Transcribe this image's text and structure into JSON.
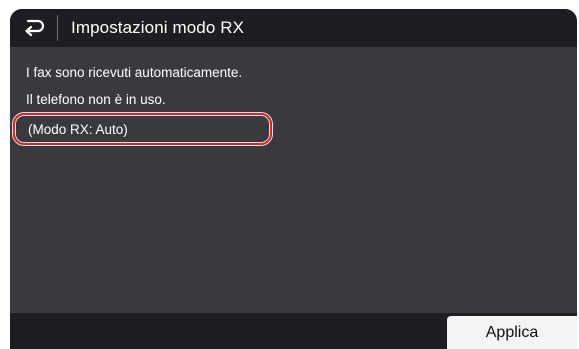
{
  "header": {
    "title": "Impostazioni modo RX",
    "back_icon": "back-arrow-icon"
  },
  "content": {
    "lines": [
      "I fax sono ricevuti automaticamente.",
      "Il telefono non è in uso.",
      "(Modo RX: Auto)"
    ],
    "highlight_color": "#d9262c"
  },
  "footer": {
    "apply_label": "Applica"
  },
  "colors": {
    "screen_background": "#383a3e",
    "bar_background": "#1d1e21",
    "text": "#ffffff"
  }
}
